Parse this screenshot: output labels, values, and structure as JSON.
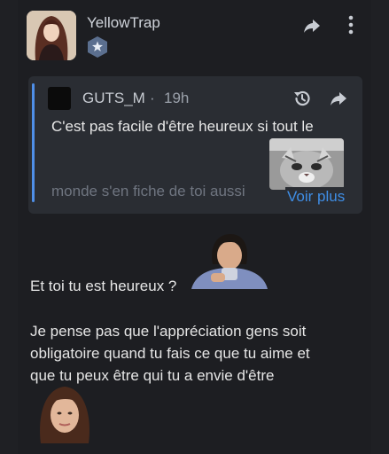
{
  "post": {
    "author": "YellowTrap"
  },
  "quote": {
    "author": "GUTS_M",
    "separator": "·",
    "time": "19h",
    "text_line1": "C'est pas facile d'être heureux si tout le",
    "text_line2": "monde s'en fiche de toi aussi",
    "more_label": "Voir plus"
  },
  "body": {
    "line1": "Et toi tu est heureux ?",
    "line2": "Je pense pas que l'appréciation gens soit",
    "line3": "obligatoire quand tu fais ce que tu aime et",
    "line4": "que tu peux être qui tu a envie d'être"
  },
  "colors": {
    "background": "#1f2024",
    "quote_bg": "#2a2d33",
    "accent": "#3f8ee6",
    "quote_bar": "#4f8fe8",
    "badge": "#5b6f8f"
  },
  "icons": {
    "share": "share-arrow-icon",
    "more": "more-vertical-icon",
    "history": "history-icon",
    "badge": "star-hexagon-icon"
  }
}
